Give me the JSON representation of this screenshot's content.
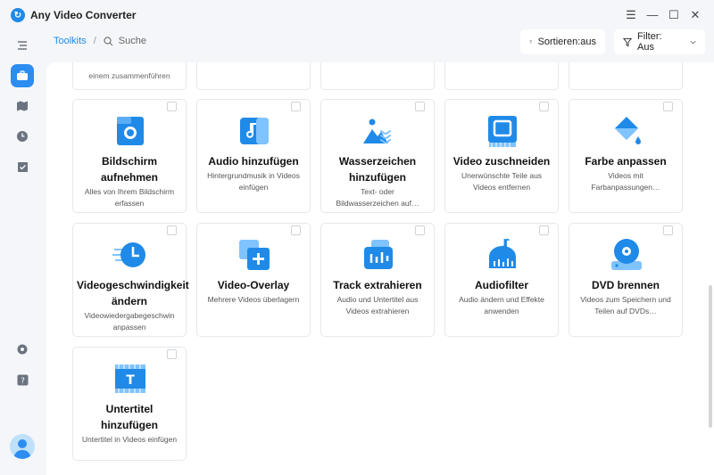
{
  "app": {
    "title": "Any Video Converter",
    "logo_glyph": "↻"
  },
  "window": {
    "menu_icon": "☰",
    "minimize": "—",
    "maximize": "☐",
    "close": "✕"
  },
  "toolbar": {
    "breadcrumb_link": "Toolkits",
    "breadcrumb_sep": "/",
    "search_label": "Suche",
    "sort_label": "Sortieren:aus",
    "filter_label": "Filter: Aus"
  },
  "colors": {
    "accent": "#2d8cf0",
    "icon_blue": "#1f8ae8",
    "icon_light": "#7fc3ff"
  },
  "partial_row": {
    "first_desc": "einem zusammenführen"
  },
  "cards": [
    {
      "title": "Bildschirm aufnehmen",
      "desc": "Alles von Ihrem Bildschirm erfassen",
      "icon": "screen-record-icon"
    },
    {
      "title": "Audio hinzufügen",
      "desc": "Hintergrundmusik in Videos einfügen",
      "icon": "add-audio-icon"
    },
    {
      "title": "Wasserzeichen hinzufügen",
      "desc": "Text- oder Bildwasserzeichen auf…",
      "icon": "watermark-icon"
    },
    {
      "title": "Video zuschneiden",
      "desc": "Unerwünschte Teile aus Videos entfernen",
      "icon": "crop-video-icon"
    },
    {
      "title": "Farbe anpassen",
      "desc": "Videos mit Farbanpassungen…",
      "icon": "color-adjust-icon"
    },
    {
      "title": "Videogeschwindigkeit ändern",
      "desc": "Videowiedergabegeschwin anpassen",
      "icon": "video-speed-icon"
    },
    {
      "title": "Video-Overlay",
      "desc": "Mehrere Videos überlagern",
      "icon": "video-overlay-icon"
    },
    {
      "title": "Track extrahieren",
      "desc": "Audio und Untertitel aus Videos extrahieren",
      "icon": "extract-track-icon"
    },
    {
      "title": "Audiofilter",
      "desc": "Audio ändern und Effekte anwenden",
      "icon": "audio-filter-icon"
    },
    {
      "title": "DVD brennen",
      "desc": "Videos zum Speichern und Teilen auf DVDs…",
      "icon": "dvd-burn-icon"
    },
    {
      "title": "Untertitel hinzufügen",
      "desc": "Untertitel in Videos einfügen",
      "icon": "add-subtitle-icon"
    }
  ]
}
